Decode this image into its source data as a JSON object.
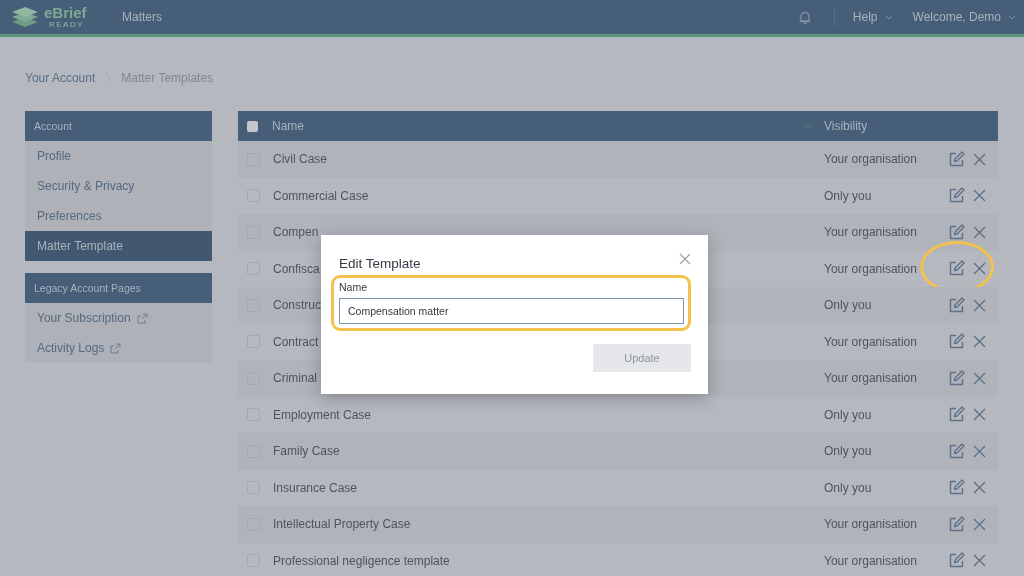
{
  "header": {
    "logo": {
      "name": "eBrief",
      "tagline": "READY"
    },
    "nav": [
      "Matters"
    ],
    "help": "Help",
    "user": "Welcome, Demo"
  },
  "breadcrumb": [
    "Your Account",
    "Matter Templates"
  ],
  "sidebar": [
    {
      "title": "Account",
      "items": [
        {
          "label": "Profile",
          "selected": false,
          "external": false
        },
        {
          "label": "Security & Privacy",
          "selected": false,
          "external": false
        },
        {
          "label": "Preferences",
          "selected": false,
          "external": false
        },
        {
          "label": "Matter Template",
          "selected": true,
          "external": false
        }
      ]
    },
    {
      "title": "Legacy Account Pages",
      "items": [
        {
          "label": "Your Subscription",
          "selected": false,
          "external": true
        },
        {
          "label": "Activity Logs",
          "selected": false,
          "external": true
        }
      ]
    }
  ],
  "table": {
    "columns": [
      "Name",
      "Visibility"
    ],
    "select_all": {
      "checked": false
    },
    "rows": [
      {
        "name": "Civil Case",
        "visibility": "Your organisation",
        "checked": false
      },
      {
        "name": "Commercial Case",
        "visibility": "Only you",
        "checked": false
      },
      {
        "name": "Compen",
        "visibility": "Your organisation",
        "checked": false
      },
      {
        "name": "Confisca",
        "visibility": "Your organisation",
        "checked": false,
        "highlighted": true
      },
      {
        "name": "Construc",
        "visibility": "Only you",
        "checked": false
      },
      {
        "name": "Contract",
        "visibility": "Your organisation",
        "checked": false
      },
      {
        "name": "Criminal",
        "visibility": "Your organisation",
        "checked": false
      },
      {
        "name": "Employment Case",
        "visibility": "Only you",
        "checked": false
      },
      {
        "name": "Family Case",
        "visibility": "Only you",
        "checked": false
      },
      {
        "name": "Insurance Case",
        "visibility": "Only you",
        "checked": false
      },
      {
        "name": "Intellectual Property Case",
        "visibility": "Your organisation",
        "checked": false
      },
      {
        "name": "Professional negligence template",
        "visibility": "Your organisation",
        "checked": false
      }
    ]
  },
  "dialog": {
    "title": "Edit Template",
    "field_label": "Name",
    "field_value": "Compensation matter",
    "button": "Update",
    "button_disabled": true
  }
}
